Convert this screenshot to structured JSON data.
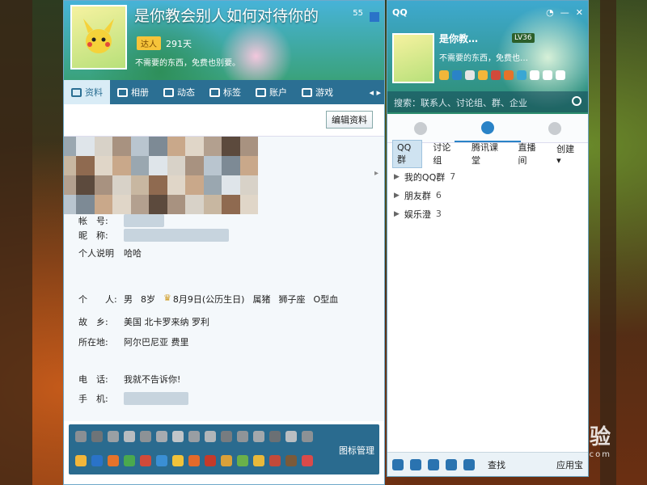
{
  "profile": {
    "title": "是你教会别人如何对待你的",
    "badge": "达人",
    "days": "291天",
    "signature": "不需要的东西，免费也别要。",
    "count": "55",
    "tabs": [
      {
        "label": "资料",
        "icon": "profile-card-icon"
      },
      {
        "label": "相册",
        "icon": "photo-icon"
      },
      {
        "label": "动态",
        "icon": "feed-icon"
      },
      {
        "label": "标签",
        "icon": "tag-icon"
      },
      {
        "label": "账户",
        "icon": "wallet-icon"
      },
      {
        "label": "游戏",
        "icon": "game-icon"
      }
    ],
    "edit_button": "编辑资料",
    "fields": {
      "account_label": "帐　号:",
      "nickname_label": "昵　称:",
      "bio_label": "个人说明",
      "bio_value": "哈哈",
      "personal_label": "个　　人:",
      "gender": "男",
      "age": "8岁",
      "birthday": "8月9日(公历生日)",
      "zodiac": "属猪",
      "constellation": "狮子座",
      "blood": "O型血",
      "hometown_label": "故　乡:",
      "hometown_value": "美国 北卡罗来纳 罗利",
      "location_label": "所在地:",
      "location_value": "阿尔巴尼亚 费里",
      "phone_label": "电　话:",
      "phone_value": "我就不告诉你!",
      "mobile_label": "手　机:"
    },
    "icon_manage": "图标管理",
    "colors": {
      "tab_bar": "#2b6f93",
      "icon_bar": "#2a6b8f",
      "active_tab": "#d9ecf6"
    }
  },
  "qq": {
    "logo": "QQ",
    "name": "是你教…",
    "signature": "不需要的东西，免费也…",
    "level": "LV36",
    "search_placeholder": "搜索：联系人、讨论组、群、企业",
    "subtabs": [
      "QQ群",
      "讨论组",
      "腾讯课堂",
      "直播间",
      "创建 ▾"
    ],
    "groups": [
      {
        "name": "我的QQ群",
        "count": "7"
      },
      {
        "name": "朋友群",
        "count": "6"
      },
      {
        "name": "娱乐澄",
        "count": "3"
      }
    ],
    "footer": {
      "search": "查找",
      "apps": "应用宝"
    },
    "accent": "#2a83c7"
  },
  "watermark": {
    "brand": "Bai du 经验",
    "url": "jingyan.baidu.com"
  }
}
